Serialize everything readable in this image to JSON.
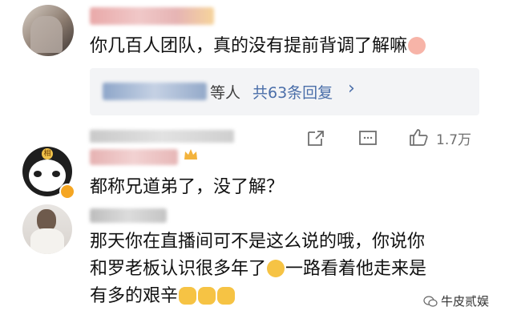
{
  "comments": [
    {
      "user": "",
      "text": "你几百人团队，真的没有提前背调了解嘛",
      "emoji": "fox-emoji",
      "reply_summary": {
        "others": "等人",
        "count": "共63条回复"
      },
      "meta": {
        "likes": "1.7万"
      }
    },
    {
      "text": "都称兄道弟了，没了解？",
      "avatar_label": "相"
    },
    {
      "text_line1": "那天你在直播间可不是这么说的哦，你说你",
      "text_line2": "和罗老板认识很多年了",
      "text_line2b": "一路看着他走来是",
      "text_line3": "有多的艰辛"
    }
  ],
  "watermark": {
    "text": "牛皮贰娱"
  },
  "colors": {
    "accent_blue": "#4a6ea9",
    "meta_gray": "#9b9b9b",
    "emoji_yellow": "#f6c344"
  }
}
